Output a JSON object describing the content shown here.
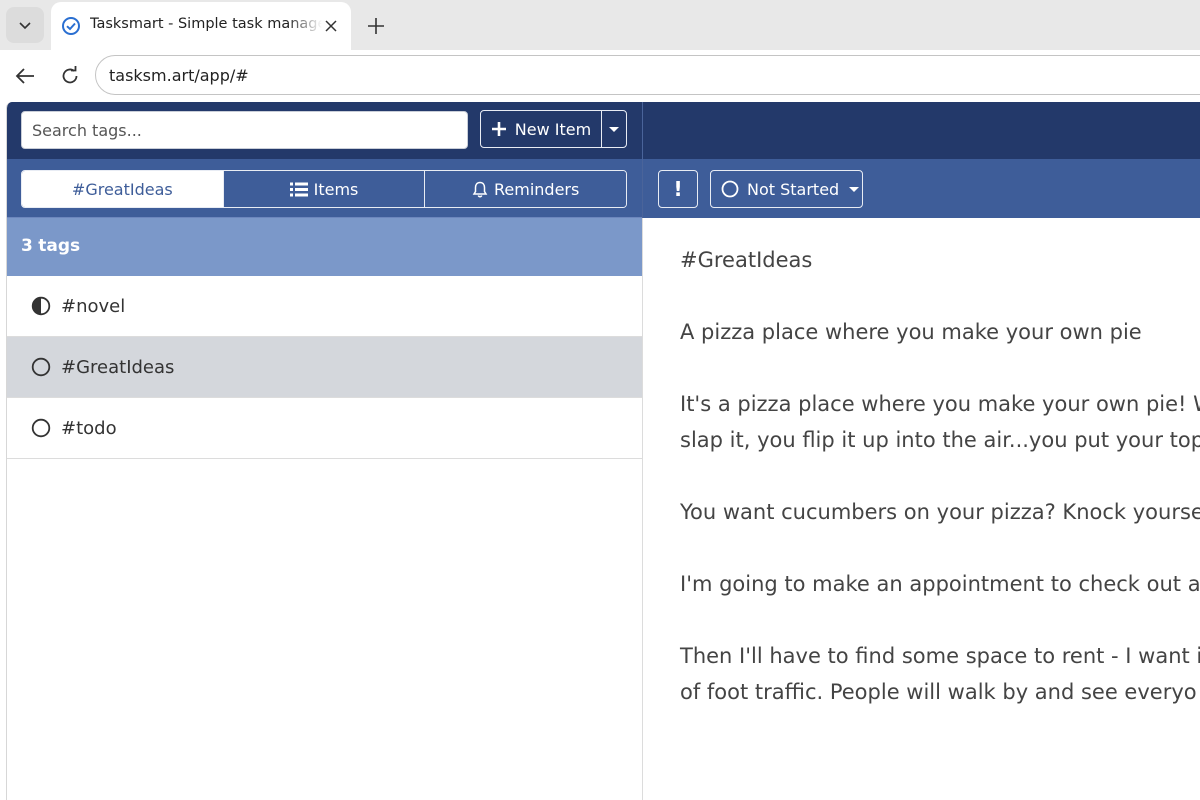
{
  "browser": {
    "tab_title": "Tasksmart - Simple task management",
    "url": "tasksm.art/app/#",
    "icons": {
      "tab_list": "chevron-down-icon",
      "favicon": "check-circle-icon",
      "close": "close-icon",
      "new_tab": "plus-icon",
      "back": "arrow-left-icon",
      "reload": "reload-icon"
    }
  },
  "header": {
    "search_placeholder": "Search tags...",
    "new_item_label": "New Item"
  },
  "view_tabs": [
    {
      "label": "#GreatIdeas",
      "active": true
    },
    {
      "label": "Items",
      "icon": "list-icon"
    },
    {
      "label": "Reminders",
      "icon": "bell-icon"
    }
  ],
  "toolbar": {
    "priority_label": "!",
    "status_label": "Not Started"
  },
  "tags": {
    "count": "3",
    "count_label": "tags",
    "items": [
      {
        "label": "#novel",
        "icon": "half-circle-icon"
      },
      {
        "label": "#GreatIdeas",
        "icon": "circle-outline-icon",
        "selected": true
      },
      {
        "label": "#todo",
        "icon": "circle-outline-icon"
      }
    ]
  },
  "note": {
    "title": "#GreatIdeas",
    "heading": "A pizza place where you make your own pie",
    "para1_line1": "It's a pizza place where you make your own pie! W",
    "para1_line2": "slap it, you flip it up into the air...you put your top",
    "para2": "You want cucumbers on your pizza? Knock yourse",
    "para3": "I'm going to make an appointment to check out a",
    "para4_line1": "Then I'll have to find some space to rent - I want i",
    "para4_line2": "of foot traffic.  People will walk by and see everyo"
  },
  "colors": {
    "navy": "#23396a",
    "mid_blue": "#3e5d99",
    "light_blue": "#7b98c9",
    "selected_row": "#d4d7dc"
  }
}
